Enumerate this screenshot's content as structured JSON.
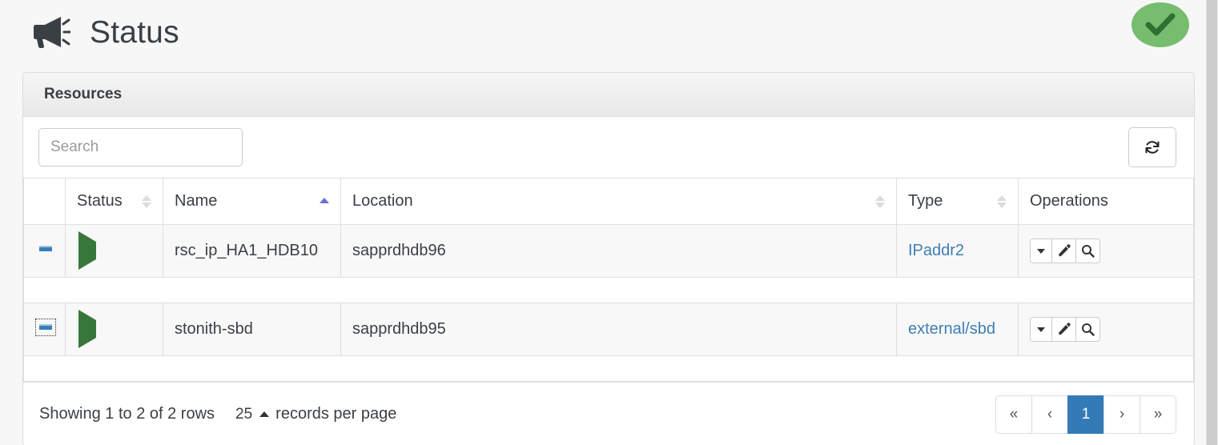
{
  "header": {
    "title": "Status",
    "icon": "bullhorn-icon",
    "status_badge": {
      "icon": "check-icon",
      "color": "#76bd6f"
    }
  },
  "panel": {
    "title": "Resources"
  },
  "toolbar": {
    "search_placeholder": "Search",
    "search_value": "",
    "refresh_icon": "refresh-icon"
  },
  "table": {
    "columns": [
      {
        "label": "",
        "sortable": false,
        "sort": "none"
      },
      {
        "label": "Status",
        "sortable": true,
        "sort": "none"
      },
      {
        "label": "Name",
        "sortable": true,
        "sort": "asc"
      },
      {
        "label": "Location",
        "sortable": true,
        "sort": "none"
      },
      {
        "label": "Type",
        "sortable": true,
        "sort": "none"
      },
      {
        "label": "Operations",
        "sortable": false,
        "sort": "none"
      }
    ],
    "rows": [
      {
        "expanded": false,
        "focused": false,
        "status": "running",
        "name": "rsc_ip_HA1_HDB10",
        "location": "sapprdhdb96",
        "type": "IPaddr2",
        "operations": [
          "caret-down-icon",
          "pencil-icon",
          "magnifier-icon"
        ]
      },
      {
        "expanded": false,
        "focused": true,
        "status": "running",
        "name": "stonith-sbd",
        "location": "sapprdhdb95",
        "type": "external/sbd",
        "operations": [
          "caret-down-icon",
          "pencil-icon",
          "magnifier-icon"
        ]
      }
    ]
  },
  "footer": {
    "showing_text": "Showing 1 to 2 of 2 rows",
    "page_size": "25",
    "records_label": "records per page",
    "pagination": {
      "first": "«",
      "prev": "‹",
      "pages": [
        "1"
      ],
      "active_page": "1",
      "next": "›",
      "last": "»"
    }
  },
  "colors": {
    "accent_blue": "#337ab7",
    "link_blue": "#3e7eb5",
    "running_green": "#38773c",
    "badge_green": "#76bd6f",
    "sort_active": "#6b6fd0"
  }
}
